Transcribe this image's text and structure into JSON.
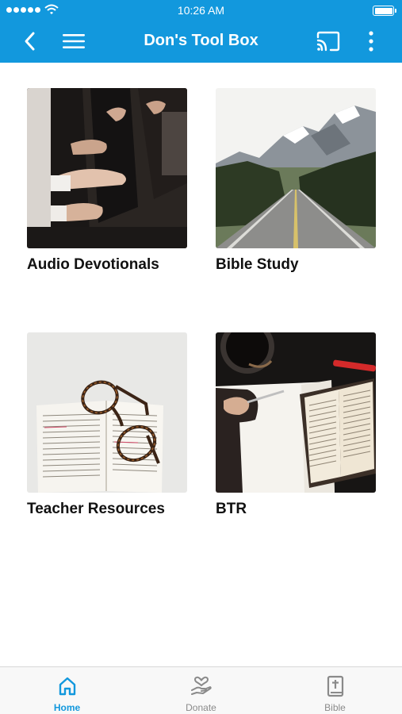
{
  "status_bar": {
    "time": "10:26 AM"
  },
  "header": {
    "title": "Don's Tool Box",
    "icons": [
      "chevron-left-icon",
      "hamburger-menu-icon",
      "cast-icon",
      "more-vertical-icon"
    ]
  },
  "tiles": [
    {
      "label": "Audio Devotionals",
      "image": "worship-hands-photo"
    },
    {
      "label": "Bible Study",
      "image": "mountain-road-photo"
    },
    {
      "label": "Teacher Resources",
      "image": "glasses-on-book-photo"
    },
    {
      "label": "BTR",
      "image": "bible-notebook-coffee-photo"
    }
  ],
  "tabbar": {
    "items": [
      {
        "label": "Home",
        "icon": "home-icon",
        "active": true
      },
      {
        "label": "Donate",
        "icon": "donate-hand-heart-icon",
        "active": false
      },
      {
        "label": "Bible",
        "icon": "bible-book-icon",
        "active": false
      }
    ]
  },
  "colors": {
    "brand": "#1298dd",
    "text": "#111111",
    "inactive": "#8a8a8a"
  }
}
